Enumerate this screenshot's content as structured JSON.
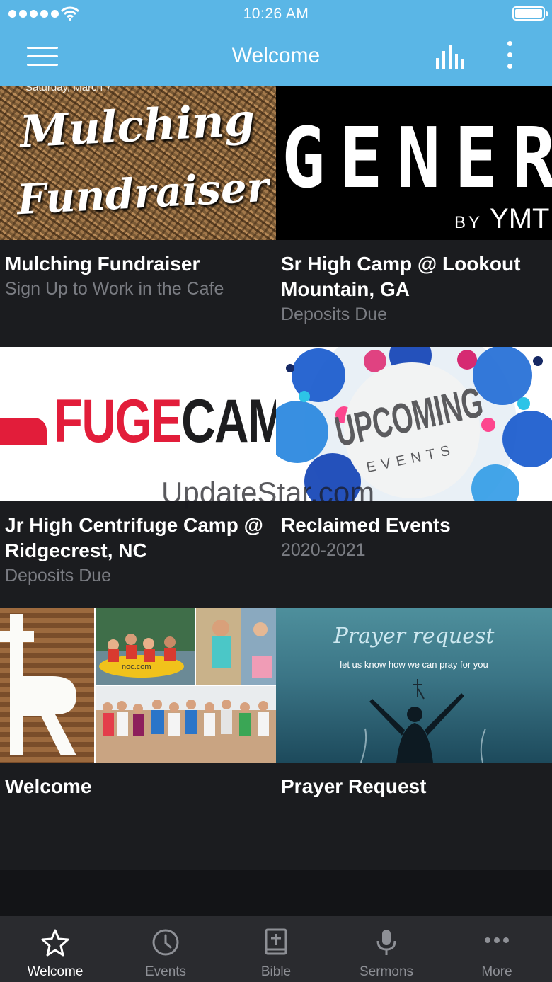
{
  "status_bar": {
    "time": "10:26 AM"
  },
  "header": {
    "title": "Welcome"
  },
  "tiles": [
    {
      "title": "Mulching Fundraiser",
      "subtitle": "Sign Up to Work in the Cafe",
      "image_text": {
        "date": "Saturday, March 7",
        "line1": "Mulching",
        "line2": "Fundraiser"
      }
    },
    {
      "title": "Sr High Camp @ Lookout Mountain, GA",
      "subtitle": "Deposits Due",
      "image_text": {
        "main": "GENERAT",
        "by": "BY",
        "brand": "YMT"
      }
    },
    {
      "title": "Jr High Centrifuge Camp @ Ridgecrest, NC",
      "subtitle": "Deposits Due",
      "image_text": {
        "red": "FUGE",
        "dark": "CAMP"
      }
    },
    {
      "title": "Reclaimed Events",
      "subtitle": "2020-2021",
      "image_text": {
        "main": "UPCOMING",
        "sub": "EVENTS"
      }
    },
    {
      "title": "Welcome",
      "subtitle": "",
      "image_text": {
        "raft": "noc.com"
      }
    },
    {
      "title": "Prayer Request",
      "subtitle": "",
      "image_text": {
        "title": "Prayer request",
        "sub": "let us know how we can pray for you"
      }
    }
  ],
  "watermark": "UpdateStar.com",
  "tab_bar": [
    {
      "label": "Welcome",
      "icon": "star-icon",
      "active": true
    },
    {
      "label": "Events",
      "icon": "clock-icon",
      "active": false
    },
    {
      "label": "Bible",
      "icon": "bible-icon",
      "active": false
    },
    {
      "label": "Sermons",
      "icon": "microphone-icon",
      "active": false
    },
    {
      "label": "More",
      "icon": "more-dots-icon",
      "active": false
    }
  ],
  "colors": {
    "header": "#5ab6e6",
    "background": "#131417",
    "tile": "#1b1c1f",
    "tab_bar": "#2a2b2f",
    "subtitle": "#7a7c82",
    "fuge_red": "#e21d3a"
  }
}
